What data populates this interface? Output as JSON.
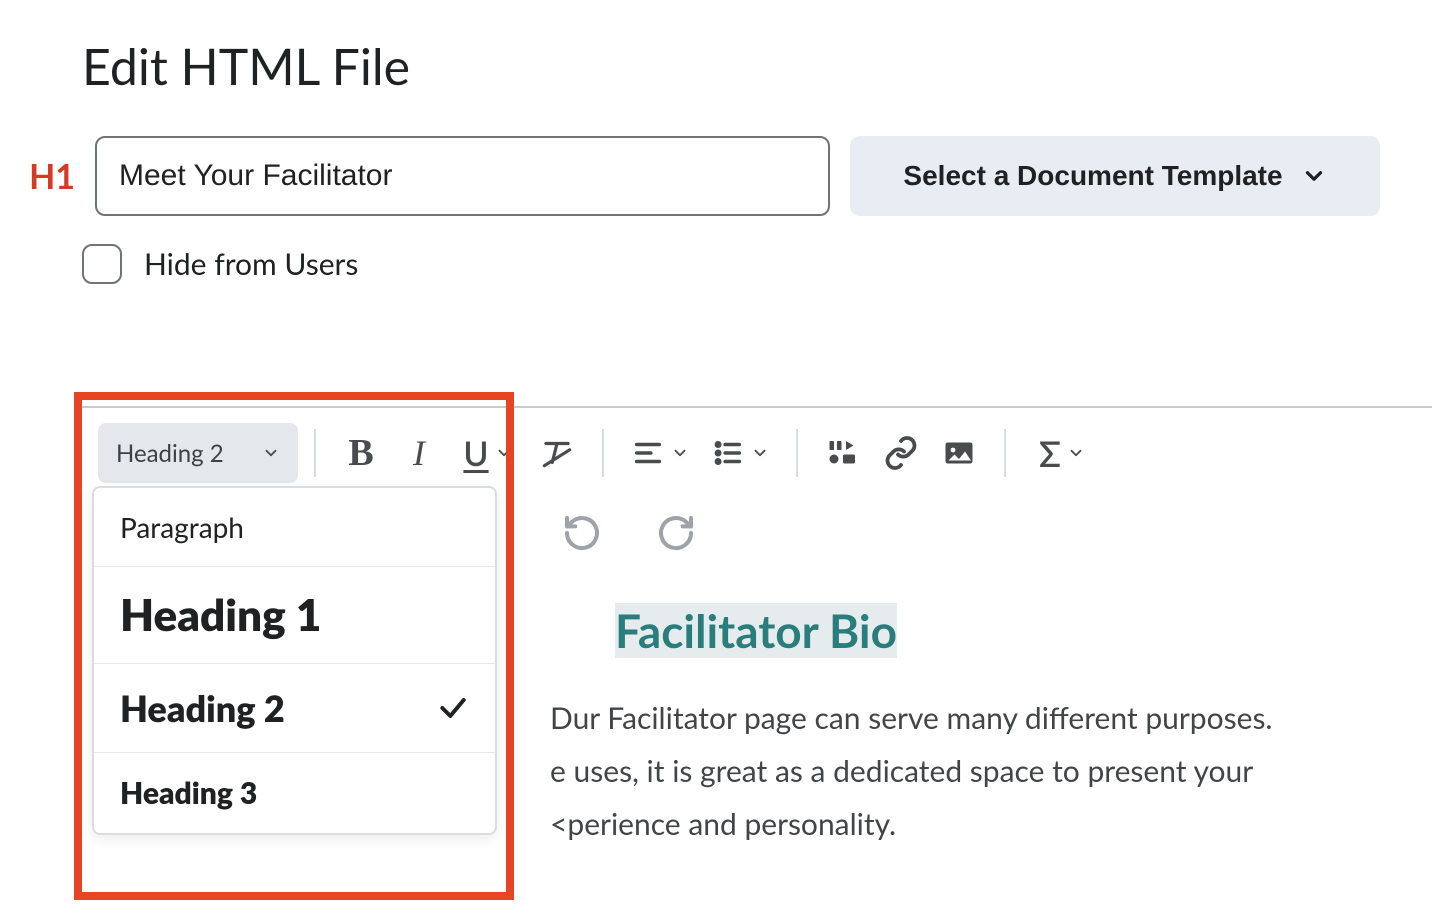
{
  "page_title": "Edit HTML File",
  "h1_label": "H1",
  "title_input_value": "Meet Your Facilitator",
  "template_button_label": "Select a Document Template",
  "hide_checkbox_label": "Hide from Users",
  "toolbar": {
    "format_select_current": "Heading 2",
    "format_options": {
      "paragraph": "Paragraph",
      "h1": "Heading 1",
      "h2": "Heading 2",
      "h3": "Heading 3"
    },
    "format_selected_key": "h2"
  },
  "content": {
    "heading": "Facilitator Bio",
    "body_line1_indent": "Dur Facilitator page can serve many different purposes.",
    "body_line2_indent": "e uses, it is great as a dedicated space to present your",
    "body_line3_indent": "<perience and personality."
  }
}
